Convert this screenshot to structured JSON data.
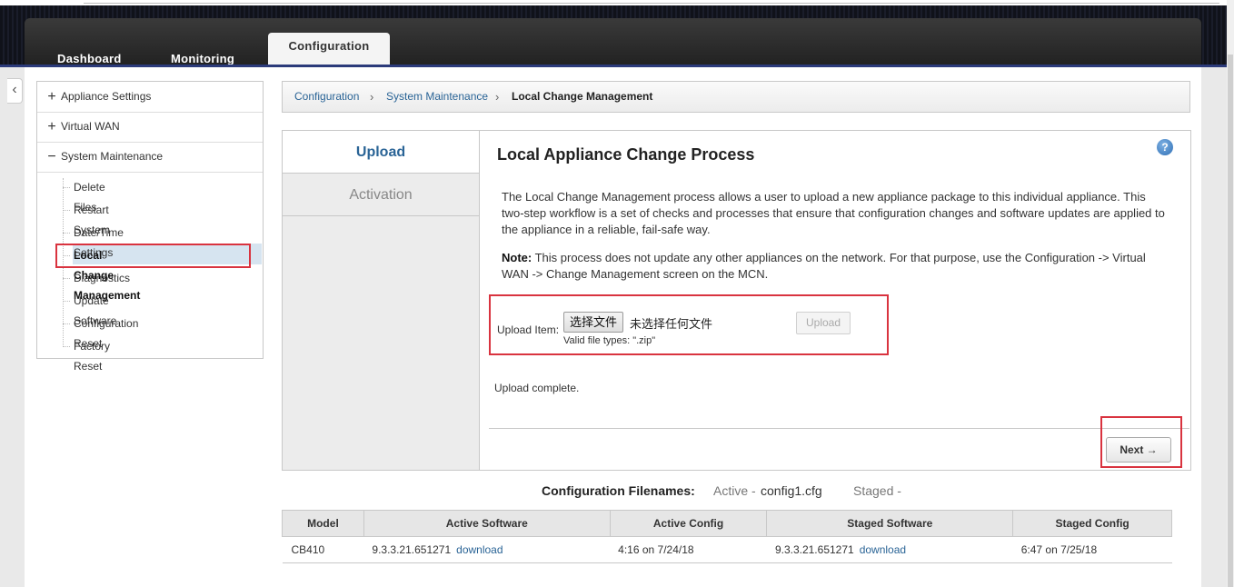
{
  "nav": {
    "tabs": [
      "Dashboard",
      "Monitoring",
      "Configuration"
    ],
    "active_tab": "Configuration"
  },
  "sidebar": {
    "sections": [
      {
        "toggle": "+",
        "label": "Appliance Settings"
      },
      {
        "toggle": "+",
        "label": "Virtual WAN"
      },
      {
        "toggle": "−",
        "label": "System Maintenance"
      }
    ],
    "items": [
      "Delete Files",
      "Restart System",
      "Date/Time Settings",
      "Local Change Management",
      "Diagnostics",
      "Update Software",
      "Configuration Reset",
      "Factory Reset"
    ],
    "selected": "Local Change Management"
  },
  "breadcrumb": [
    "Configuration",
    "System Maintenance",
    "Local Change Management"
  ],
  "wizard": {
    "steps": [
      "Upload",
      "Activation"
    ],
    "title": "Local Appliance Change Process",
    "help": "?",
    "description": "The Local Change Management process allows a user to upload a new appliance package to this individual appliance. This two-step workflow is a set of checks and processes that ensure that configuration changes and software updates are applied to the appliance in a reliable, fail-safe way.",
    "note_label": "Note:",
    "note_text": " This process does not update any other appliances on the network. For that purpose, use the Configuration -> Virtual WAN -> Change Management screen on the MCN.",
    "upload_label": "Upload Item:",
    "choose_file": "选择文件",
    "no_file": "未选择任何文件",
    "valid_types": "Valid file types: \".zip\"",
    "upload_button": "Upload",
    "status": "Upload complete.",
    "next_button": "Next →"
  },
  "config_filenames": {
    "label": "Configuration Filenames:",
    "active_key": "Active -",
    "active_value": "config1.cfg",
    "staged_key": "Staged -"
  },
  "software_table": {
    "headers": [
      "Model",
      "Active Software",
      "Active Config",
      "Staged Software",
      "Staged Config"
    ],
    "row": {
      "model": "CB410",
      "active_software": "9.3.3.21.651271",
      "active_link": "download",
      "active_config": "4:16 on 7/24/18",
      "staged_software": "9.3.3.21.651271",
      "staged_link": "download",
      "staged_config": "6:47 on 7/25/18"
    }
  },
  "colors": {
    "link": "#2a6496",
    "highlight": "#d9333f",
    "selected_bg": "#d6e4f0"
  }
}
